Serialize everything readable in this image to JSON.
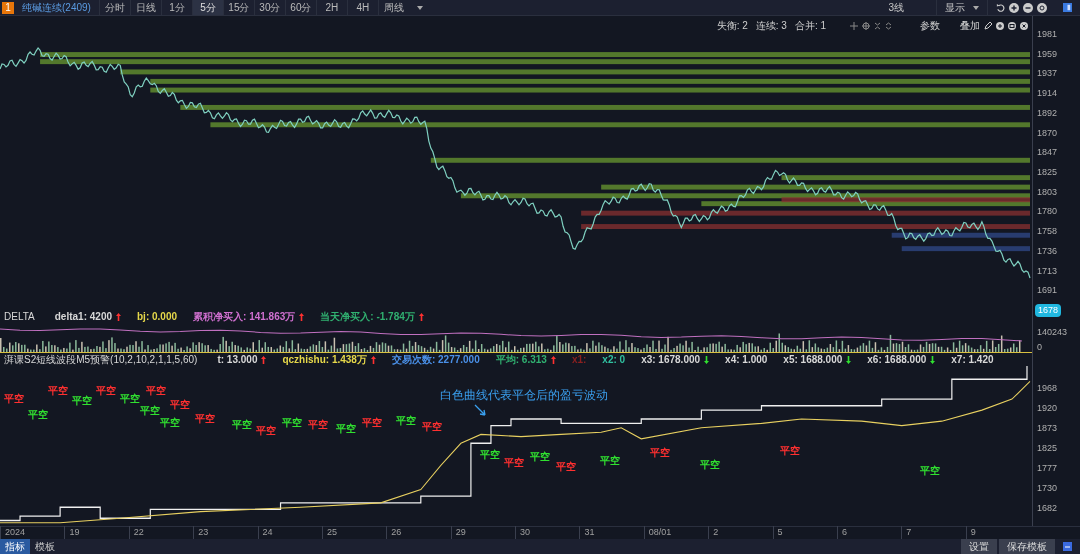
{
  "toolbar": {
    "badge": "1",
    "symbol": "纯碱连续(2409)",
    "periods": [
      {
        "label": "分时",
        "selected": false
      },
      {
        "label": "日线",
        "selected": false
      },
      {
        "label": "1分",
        "selected": false
      },
      {
        "label": "5分",
        "selected": true
      },
      {
        "label": "15分",
        "selected": false
      },
      {
        "label": "30分",
        "selected": false
      },
      {
        "label": "60分",
        "selected": false
      },
      {
        "label": "2H",
        "selected": false
      },
      {
        "label": "4H",
        "selected": false
      },
      {
        "label": "周线",
        "selected": false
      }
    ],
    "layout": "3线",
    "display": "显示"
  },
  "chart_header": {
    "params": [
      {
        "label": "失衡:",
        "value": "2"
      },
      {
        "label": "连续:",
        "value": "3"
      },
      {
        "label": "合并:",
        "value": "1"
      }
    ],
    "settings": "参数",
    "overlay": "叠加"
  },
  "price_axis": {
    "ticks": [
      "1981",
      "1959",
      "1937",
      "1914",
      "1892",
      "1870",
      "1847",
      "1825",
      "1803",
      "1780",
      "1758",
      "1736",
      "1713",
      "1691"
    ],
    "current": "1678"
  },
  "delta": {
    "name": "DELTA",
    "stats": [
      {
        "text": "delta1: 4200",
        "color": "#d8d8d8",
        "rising": true
      },
      {
        "text": "bj: 0.000",
        "color": "#e6d84a"
      },
      {
        "text": "累积净买入: 141.863万",
        "color": "#d070d0",
        "rising": true
      },
      {
        "text": "当天净买入: -1.784万",
        "color": "#30b070",
        "rising": true
      }
    ],
    "axis": [
      "140243",
      "0"
    ]
  },
  "strategy": {
    "name": "湃课S2短线波段M5预警(10,2,10,2,1,1,5,60)",
    "stats": [
      {
        "text": "t: 13.000",
        "color": "#d8d8d8",
        "rising": true
      },
      {
        "text": "qczhishu: 1.438万",
        "color": "#e6d84a",
        "rising": true
      },
      {
        "text": "交易次数: 2277.000",
        "color": "#4a90e8"
      },
      {
        "text": "平均: 6.313",
        "color": "#30b070",
        "rising": true
      },
      {
        "text": "x1:",
        "color": "#8a2020"
      },
      {
        "text": "x2: 0",
        "color": "#30c0a0"
      },
      {
        "text": "x3: 1678.000",
        "color": "#d8d8d8",
        "rising": false
      },
      {
        "text": "x4: 1.000",
        "color": "#d8d8d8"
      },
      {
        "text": "x5: 1688.000",
        "color": "#d8d8d8",
        "rising": false
      },
      {
        "text": "x6: 1688.000",
        "color": "#d8d8d8",
        "rising": false
      },
      {
        "text": "x7: 1.420",
        "color": "#d8d8d8"
      }
    ],
    "axis": [
      "1968",
      "1920",
      "1873",
      "1825",
      "1777",
      "1730",
      "1682"
    ],
    "annotation": "白色曲线代表平仓后的盈亏波动",
    "markers": [
      {
        "text": "平空",
        "color": "#ff3030"
      },
      {
        "text": "平空",
        "color": "#30e030"
      },
      {
        "text": "平空",
        "color": "#ff3030"
      },
      {
        "text": "平空",
        "color": "#30e030"
      },
      {
        "text": "平空",
        "color": "#ff3030"
      },
      {
        "text": "平空",
        "color": "#30e030"
      },
      {
        "text": "平空",
        "color": "#ff3030"
      },
      {
        "text": "平空",
        "color": "#30e030"
      },
      {
        "text": "平空",
        "color": "#ff3030"
      },
      {
        "text": "平空",
        "color": "#30e030"
      },
      {
        "text": "平空",
        "color": "#ff3030"
      },
      {
        "text": "平空",
        "color": "#30e030"
      },
      {
        "text": "平空",
        "color": "#ff3030"
      },
      {
        "text": "平空",
        "color": "#30e030"
      },
      {
        "text": "平空",
        "color": "#ff3030"
      },
      {
        "text": "平空",
        "color": "#30e030"
      },
      {
        "text": "平空",
        "color": "#ff3030"
      },
      {
        "text": "平空",
        "color": "#30e030"
      },
      {
        "text": "平空",
        "color": "#ff3030"
      },
      {
        "text": "平空",
        "color": "#30e030"
      },
      {
        "text": "平空",
        "color": "#ff3030"
      },
      {
        "text": "平空",
        "color": "#30e030"
      },
      {
        "text": "平空",
        "color": "#ff3030"
      },
      {
        "text": "平空",
        "color": "#30e030"
      },
      {
        "text": "平空",
        "color": "#ff3030"
      },
      {
        "text": "平空",
        "color": "#30e030"
      },
      {
        "text": "平空",
        "color": "#ff3030"
      },
      {
        "text": "平空",
        "color": "#30e030"
      }
    ]
  },
  "time_axis": [
    "2024",
    "19",
    "22",
    "23",
    "24",
    "25",
    "26",
    "29",
    "30",
    "31",
    "08/01",
    "2",
    "5",
    "6",
    "7",
    "9"
  ],
  "bottom_tabs": [
    {
      "label": "指标",
      "selected": true
    },
    {
      "label": "模板",
      "selected": false
    }
  ],
  "bottom_buttons": [
    "设置",
    "保存模板"
  ]
}
